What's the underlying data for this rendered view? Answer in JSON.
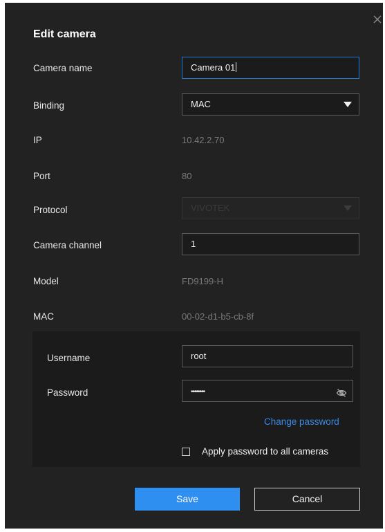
{
  "dialog": {
    "title": "Edit camera",
    "close_icon": "close-icon"
  },
  "fields": {
    "camera_name": {
      "label": "Camera name",
      "value": "Camera 01"
    },
    "binding": {
      "label": "Binding",
      "value": "MAC"
    },
    "ip": {
      "label": "IP",
      "value": "10.42.2.70"
    },
    "port": {
      "label": "Port",
      "value": "80"
    },
    "protocol": {
      "label": "Protocol",
      "value": "VIVOTEK"
    },
    "camera_channel": {
      "label": "Camera channel",
      "value": "1"
    },
    "model": {
      "label": "Model",
      "value": "FD9199-H"
    },
    "mac": {
      "label": "MAC",
      "value": "00-02-d1-b5-cb-8f"
    }
  },
  "credentials": {
    "username_label": "Username",
    "username_value": "root",
    "password_label": "Password",
    "password_value": "••••••••",
    "password_visibility_icon": "eye-off-icon",
    "change_password_link": "Change password",
    "apply_all_label": "Apply password to all cameras",
    "apply_all_checked": false
  },
  "buttons": {
    "save": "Save",
    "cancel": "Cancel"
  },
  "colors": {
    "dialog_bg": "#222222",
    "accent": "#2f8ff0",
    "link": "#3a8be8"
  }
}
